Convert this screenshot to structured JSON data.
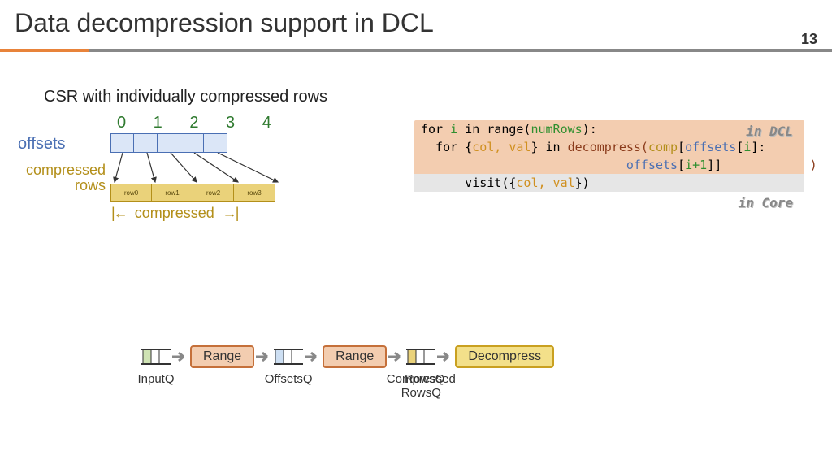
{
  "header": {
    "title": "Data decompression support in DCL",
    "page_number": "13"
  },
  "csr": {
    "caption": "CSR with individually compressed rows",
    "offsets_label": "offsets",
    "comprows_label": "compressed\nrows",
    "indices": "0  1  2  3  4",
    "row_labels": [
      "row0",
      "row1",
      "row2",
      "row3"
    ],
    "span_label": "compressed"
  },
  "code": {
    "annot_dcl": "in DCL",
    "annot_core": "in Core",
    "l1": {
      "pre": "for ",
      "i": "i",
      "mid": " in range(",
      "nr": "numRows",
      "post": "):"
    },
    "l2": {
      "pre": "  for {",
      "cv": "col, val",
      "mid": "} in ",
      "dec": "decompress(",
      "comp": "comp",
      "lb": "[",
      "off": "offsets",
      "lb2": "[",
      "i": "i",
      "rb": "]:"
    },
    "l3": {
      "pad": "                            ",
      "off": "offsets",
      "lb": "[",
      "i": "i+1",
      "rb": "]]",
      "close": "            )"
    },
    "l4": {
      "pre": "      visit({",
      "cv": "col, val",
      "post": "})"
    }
  },
  "pipeline": {
    "inputq": "InputQ",
    "offsetsq": "OffsetsQ",
    "comprowsq": "Compressed RowsQ",
    "rowsq": "RowsQ",
    "range": "Range",
    "decompress": "Decompress"
  }
}
